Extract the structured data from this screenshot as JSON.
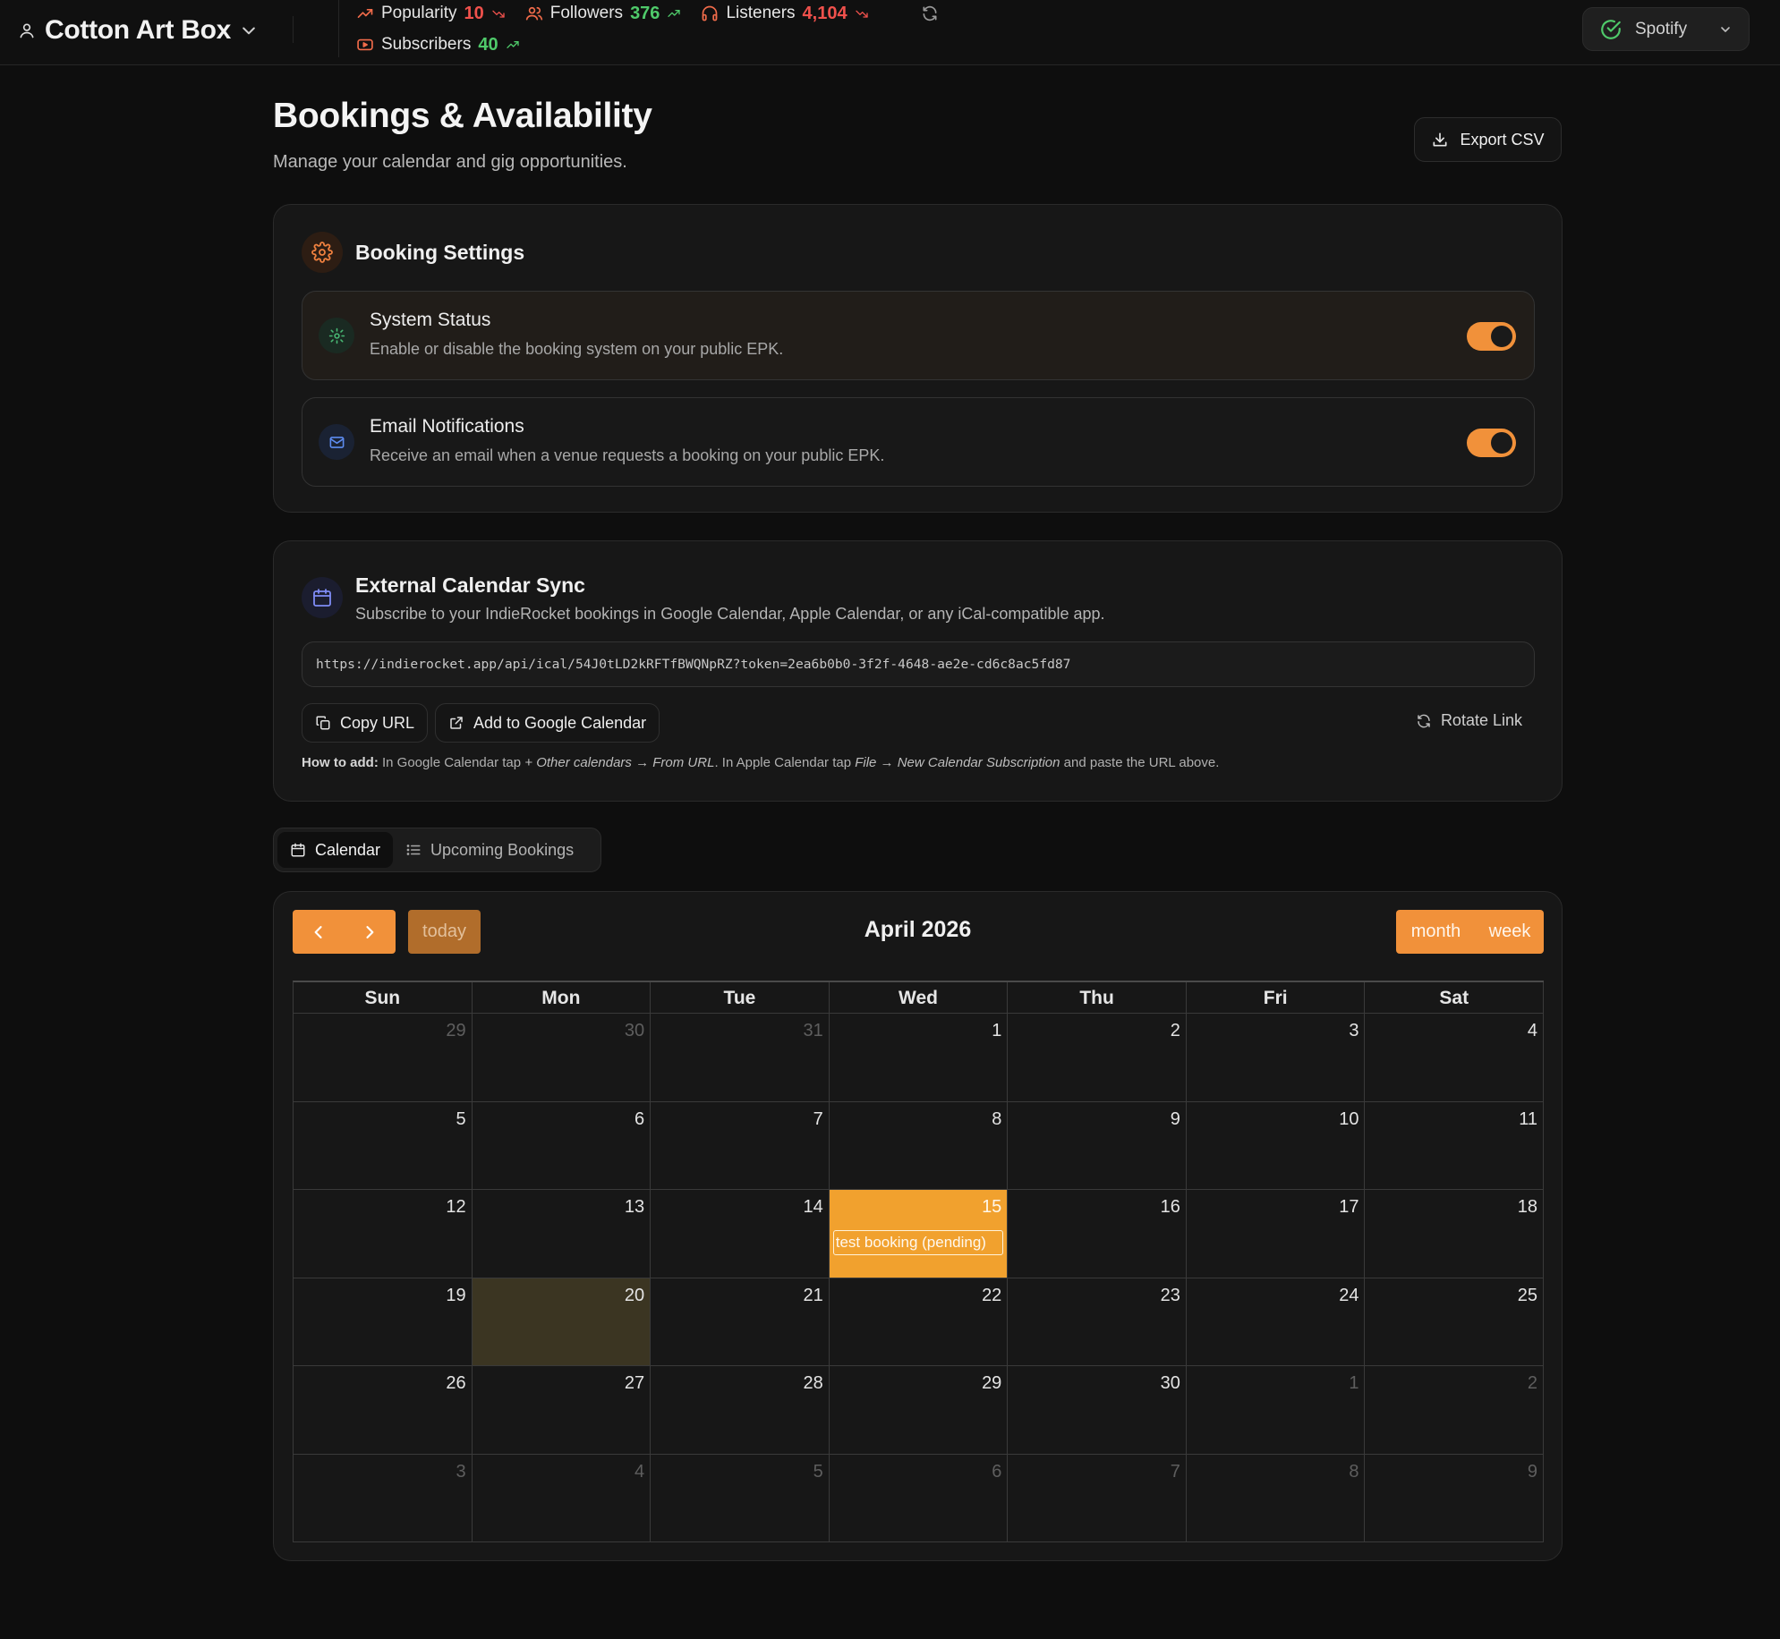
{
  "app": {
    "artist_name": "Cotton Art Box",
    "platform": "Spotify"
  },
  "stats": [
    {
      "label": "Popularity",
      "value": "10",
      "trend": "down",
      "color": "#f0514c"
    },
    {
      "label": "Followers",
      "value": "376",
      "trend": "up",
      "color": "#4fca6a"
    },
    {
      "label": "Listeners",
      "value": "4,104",
      "trend": "down",
      "color": "#f0514c"
    },
    {
      "label": "Subscribers",
      "value": "40",
      "trend": "up",
      "color": "#4fca6a"
    }
  ],
  "page": {
    "title": "Bookings & Availability",
    "subtitle": "Manage your calendar and gig opportunities.",
    "export_label": "Export CSV"
  },
  "settings": {
    "title": "Booking Settings",
    "items": [
      {
        "title": "System Status",
        "description": "Enable or disable the booking system on your public EPK.",
        "enabled": true
      },
      {
        "title": "Email Notifications",
        "description": "Receive an email when a venue requests a booking on your public EPK.",
        "enabled": true
      }
    ]
  },
  "sync": {
    "title": "External Calendar Sync",
    "description": "Subscribe to your IndieRocket bookings in Google Calendar, Apple Calendar, or any iCal-compatible app.",
    "url": "https://indierocket.app/api/ical/54J0tLD2kRFTfBWQNpRZ?token=2ea6b0b0-3f2f-4648-ae2e-cd6c8ac5fd87",
    "copy_label": "Copy URL",
    "google_label": "Add to Google Calendar",
    "rotate_label": "Rotate Link",
    "howto": {
      "lead": "How to add:",
      "t1": "In Google Calendar tap",
      "i1": "+ Other calendars → From URL",
      "t2": ". In Apple Calendar tap",
      "i2": "File → New Calendar Subscription",
      "t3": "and paste the URL above."
    }
  },
  "tabs": [
    {
      "label": "Calendar",
      "active": true,
      "icon": "calendar-icon"
    },
    {
      "label": "Upcoming Bookings",
      "active": false,
      "icon": "list-icon"
    }
  ],
  "calendar": {
    "title": "April 2026",
    "today_label": "today",
    "views": [
      "month",
      "week"
    ],
    "weekdays": [
      "Sun",
      "Mon",
      "Tue",
      "Wed",
      "Thu",
      "Fri",
      "Sat"
    ],
    "weeks": [
      [
        {
          "d": "29",
          "o": true
        },
        {
          "d": "30",
          "o": true
        },
        {
          "d": "31",
          "o": true
        },
        {
          "d": "1"
        },
        {
          "d": "2"
        },
        {
          "d": "3"
        },
        {
          "d": "4"
        }
      ],
      [
        {
          "d": "5"
        },
        {
          "d": "6"
        },
        {
          "d": "7"
        },
        {
          "d": "8"
        },
        {
          "d": "9"
        },
        {
          "d": "10"
        },
        {
          "d": "11"
        }
      ],
      [
        {
          "d": "12"
        },
        {
          "d": "13"
        },
        {
          "d": "14"
        },
        {
          "d": "15",
          "event": "test booking (pending)"
        },
        {
          "d": "16"
        },
        {
          "d": "17"
        },
        {
          "d": "18"
        }
      ],
      [
        {
          "d": "19"
        },
        {
          "d": "20",
          "today": true
        },
        {
          "d": "21"
        },
        {
          "d": "22"
        },
        {
          "d": "23"
        },
        {
          "d": "24"
        },
        {
          "d": "25"
        }
      ],
      [
        {
          "d": "26"
        },
        {
          "d": "27"
        },
        {
          "d": "28"
        },
        {
          "d": "29"
        },
        {
          "d": "30"
        },
        {
          "d": "1",
          "o": true
        },
        {
          "d": "2",
          "o": true
        }
      ],
      [
        {
          "d": "3",
          "o": true
        },
        {
          "d": "4",
          "o": true
        },
        {
          "d": "5",
          "o": true
        },
        {
          "d": "6",
          "o": true
        },
        {
          "d": "7",
          "o": true
        },
        {
          "d": "8",
          "o": true
        },
        {
          "d": "9",
          "o": true
        }
      ]
    ]
  },
  "colors": {
    "accent": "#f1913a",
    "booking": "#f1a12e",
    "today_highlight": "#3b3522",
    "background": "#0e0e0e"
  }
}
